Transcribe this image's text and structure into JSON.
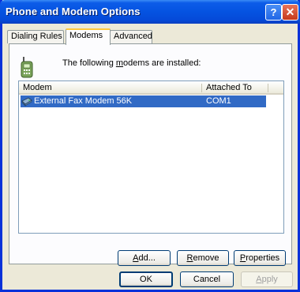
{
  "window": {
    "title": "Phone and Modem Options",
    "help_label": "?",
    "close_label": "✕"
  },
  "tabs": [
    {
      "label": "Dialing Rules"
    },
    {
      "label": "Modems"
    },
    {
      "label": "Advanced"
    }
  ],
  "panel": {
    "intro_before": "The following ",
    "intro_accel": "m",
    "intro_after": "odems are  installed:"
  },
  "list": {
    "columns": [
      "Modem",
      "Attached To"
    ],
    "rows": [
      {
        "modem": "External Fax Modem 56K",
        "attached_to": "COM1",
        "selected": true
      }
    ]
  },
  "panel_buttons": {
    "add": {
      "accel": "A",
      "rest": "dd..."
    },
    "remove": {
      "accel": "R",
      "rest": "emove"
    },
    "properties": {
      "accel": "P",
      "rest": "roperties"
    }
  },
  "dialog_buttons": {
    "ok": "OK",
    "cancel": "Cancel",
    "apply": {
      "accel": "A",
      "rest": "pply"
    }
  },
  "colors": {
    "titlebar": "#0553e1",
    "selection": "#316ac5",
    "active_tab_accent": "#ffc83c",
    "face": "#ece9d8"
  }
}
